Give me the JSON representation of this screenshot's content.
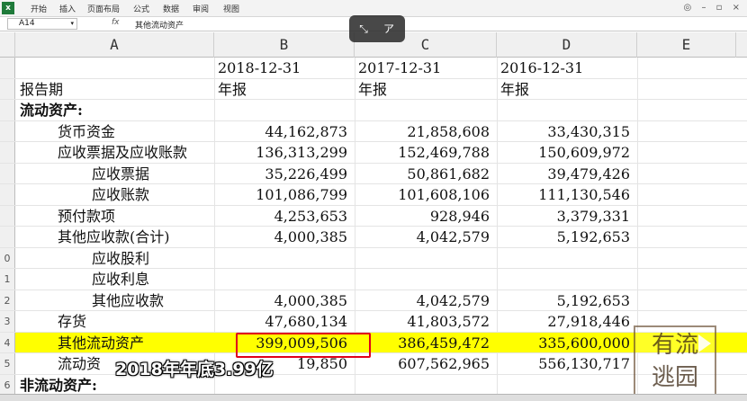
{
  "ribbon": {
    "tabs": [
      "开始",
      "插入",
      "页面布局",
      "公式",
      "数据",
      "审阅",
      "视图"
    ]
  },
  "formula_bar": {
    "cell_ref": "A14",
    "fx": "fx",
    "content": "其他流动资产"
  },
  "columns": [
    "A",
    "B",
    "C",
    "D",
    "E"
  ],
  "rows": [
    {
      "num": "",
      "a": "",
      "b": "2018-12-31",
      "c": "2017-12-31",
      "d": "2016-12-31",
      "style": "date"
    },
    {
      "num": "",
      "a": "报告期",
      "b": "年报",
      "c": "年报",
      "d": "年报",
      "style": "label"
    },
    {
      "num": "",
      "a": "流动资产:",
      "b": "",
      "c": "",
      "d": "",
      "style": "bold"
    },
    {
      "num": "",
      "a": "货币资金",
      "b": "44,162,873",
      "c": "21,858,608",
      "d": "33,430,315",
      "style": "ind1"
    },
    {
      "num": "",
      "a": "应收票据及应收账款",
      "b": "136,313,299",
      "c": "152,469,788",
      "d": "150,609,972",
      "style": "ind1"
    },
    {
      "num": "",
      "a": "应收票据",
      "b": "35,226,499",
      "c": "50,861,682",
      "d": "39,479,426",
      "style": "ind2"
    },
    {
      "num": "",
      "a": "应收账款",
      "b": "101,086,799",
      "c": "101,608,106",
      "d": "111,130,546",
      "style": "ind2"
    },
    {
      "num": "",
      "a": "预付款项",
      "b": "4,253,653",
      "c": "928,946",
      "d": "3,379,331",
      "style": "ind1"
    },
    {
      "num": "",
      "a": "其他应收款(合计)",
      "b": "4,000,385",
      "c": "4,042,579",
      "d": "5,192,653",
      "style": "ind1"
    },
    {
      "num": "0",
      "a": "应收股利",
      "b": "",
      "c": "",
      "d": "",
      "style": "ind2"
    },
    {
      "num": "1",
      "a": "应收利息",
      "b": "",
      "c": "",
      "d": "",
      "style": "ind2"
    },
    {
      "num": "2",
      "a": "其他应收款",
      "b": "4,000,385",
      "c": "4,042,579",
      "d": "5,192,653",
      "style": "ind2"
    },
    {
      "num": "3",
      "a": "存货",
      "b": "47,680,134",
      "c": "41,803,572",
      "d": "27,918,446",
      "style": "ind1"
    },
    {
      "num": "4",
      "a": "其他流动资产",
      "b": "399,009,506",
      "c": "386,459,472",
      "d": "335,600,000",
      "style": "ind1 hl"
    },
    {
      "num": "5",
      "a": "流动资",
      "b": "19,850",
      "c": "607,562,965",
      "d": "556,130,717",
      "style": "ind1"
    },
    {
      "num": "6",
      "a": "非流动资产:",
      "b": "",
      "c": "",
      "d": "",
      "style": "bold"
    }
  ],
  "subtitle": "2018年年底3.99亿",
  "watermark": "有流逃园",
  "colors": {
    "highlight": "#ffff00",
    "box": "#e0001a"
  }
}
